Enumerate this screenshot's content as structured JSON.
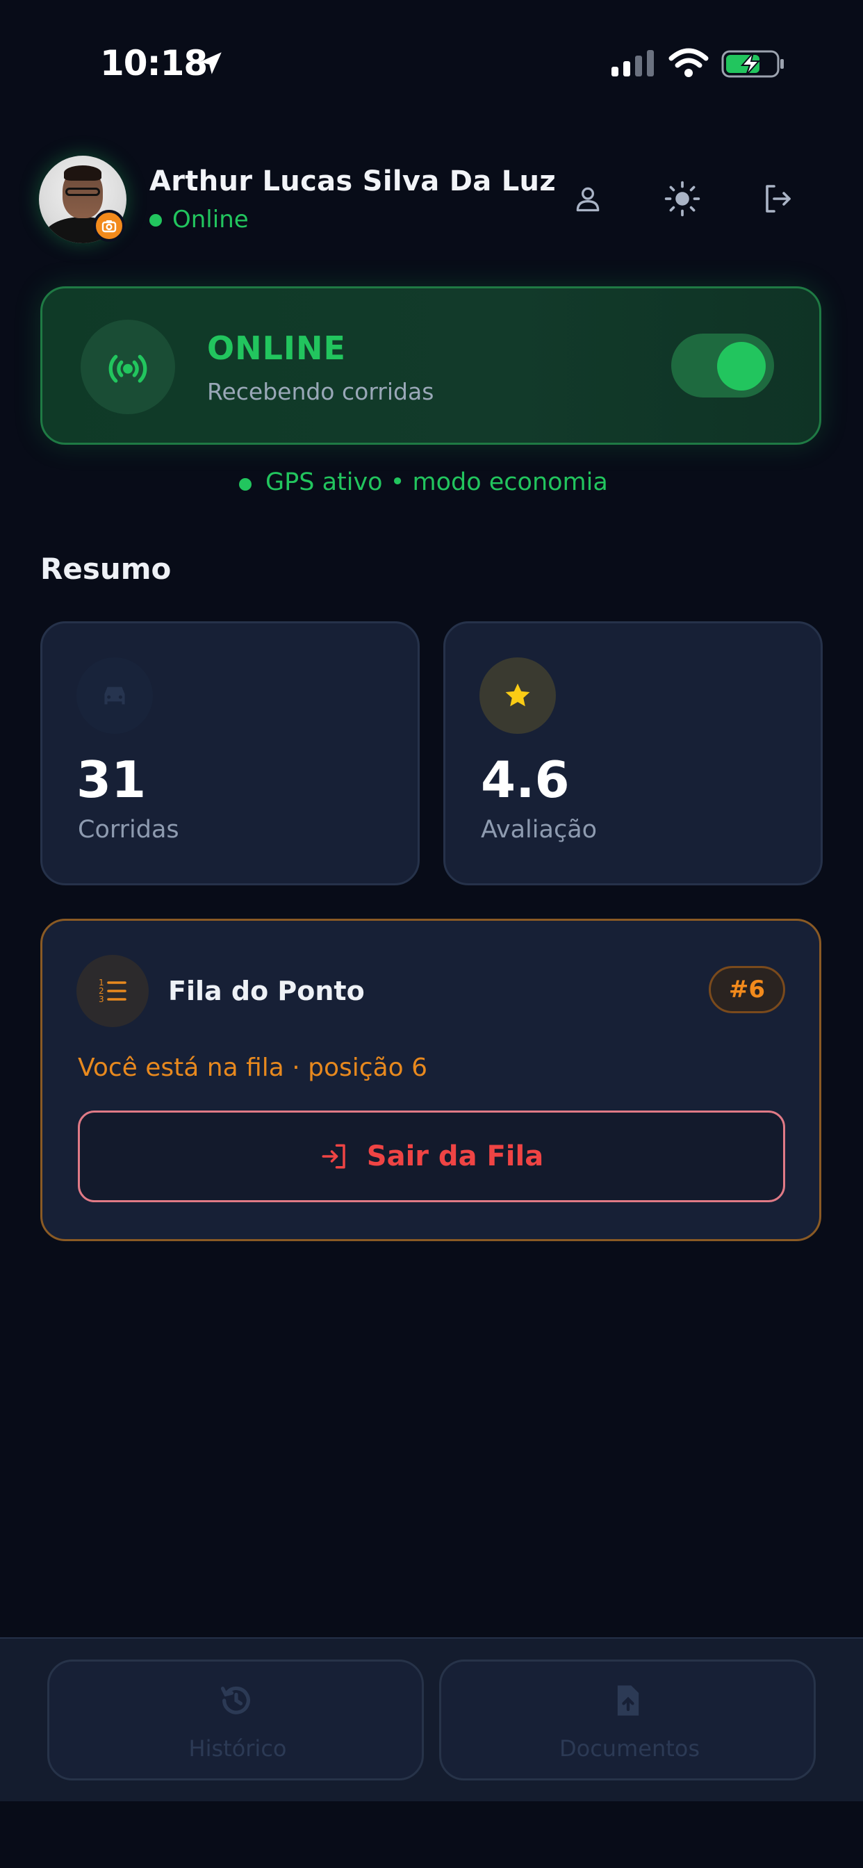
{
  "status_bar": {
    "time": "10:18"
  },
  "header": {
    "user_name": "Arthur Lucas Silva Da Luz",
    "status": "Online",
    "icons": [
      "profile-icon",
      "theme-sun-icon",
      "logout-icon"
    ]
  },
  "online_card": {
    "title": "ONLINE",
    "subtitle": "Recebendo corridas",
    "toggle_on": true
  },
  "gps": {
    "text": "GPS ativo • modo economia"
  },
  "summary": {
    "title": "Resumo",
    "cards": [
      {
        "icon": "car-icon",
        "value": "31",
        "label": "Corridas"
      },
      {
        "icon": "star-icon",
        "value": "4.6",
        "label": "Avaliação"
      }
    ]
  },
  "queue": {
    "title": "Fila do Ponto",
    "badge": "#6",
    "status": "Você está na fila · posição 6",
    "leave_button": "Sair da Fila"
  },
  "bottom_nav": [
    {
      "icon": "history-icon",
      "label": "Histórico"
    },
    {
      "icon": "document-upload-icon",
      "label": "Documentos"
    }
  ],
  "colors": {
    "background": "#080c18",
    "accent_green": "#22c55e",
    "accent_orange": "#f28a1c",
    "danger_red": "#ef4444",
    "card": "#172036"
  }
}
